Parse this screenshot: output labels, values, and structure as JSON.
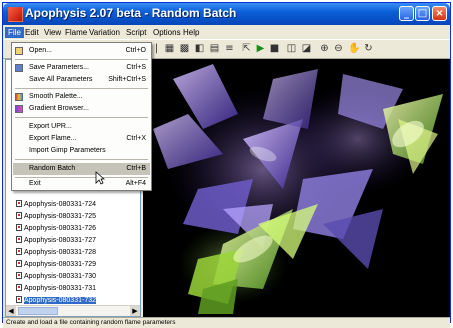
{
  "window": {
    "title": "Apophysis 2.07 beta - Random Batch",
    "minimize_icon": "minimize-icon",
    "maximize_icon": "maximize-icon",
    "close_icon": "close-icon"
  },
  "menubar": {
    "items": [
      "File",
      "Edit",
      "View",
      "Flame",
      "Variation",
      "Script",
      "Options",
      "Help"
    ]
  },
  "file_menu": {
    "items": [
      {
        "label": "Open...",
        "shortcut": "Ctrl+O",
        "icon": "open-folder-icon"
      },
      {
        "label": "Save Parameters...",
        "shortcut": "Ctrl+S",
        "icon": "save-icon"
      },
      {
        "label": "Save All Parameters",
        "shortcut": "Shift+Ctrl+S",
        "icon": ""
      },
      {
        "label": "Smooth Palette...",
        "shortcut": "",
        "icon": "palette-icon"
      },
      {
        "label": "Gradient Browser...",
        "shortcut": "",
        "icon": "gradient-icon"
      },
      {
        "label": "Export UPR...",
        "shortcut": "",
        "icon": ""
      },
      {
        "label": "Export Flame...",
        "shortcut": "Ctrl+X",
        "icon": ""
      },
      {
        "label": "Import Gimp Parameters",
        "shortcut": "",
        "icon": ""
      },
      {
        "label": "Random Batch",
        "shortcut": "Ctrl+B",
        "icon": ""
      },
      {
        "label": "Exit",
        "shortcut": "Alt+F4",
        "icon": ""
      }
    ]
  },
  "flame_list": {
    "items": [
      "Apophysis-080331-724",
      "Apophysis-080331-725",
      "Apophysis-080331-726",
      "Apophysis-080331-727",
      "Apophysis-080331-728",
      "Apophysis-080331-729",
      "Apophysis-080331-730",
      "Apophysis-080331-731",
      "Apophysis-080331-732"
    ]
  },
  "statusbar": {
    "text": "Create and load a file containing random flame parameters"
  },
  "colors": {
    "title_bar": "#0a5fd8",
    "selection": "#316ac5",
    "canvas": "#000000"
  }
}
